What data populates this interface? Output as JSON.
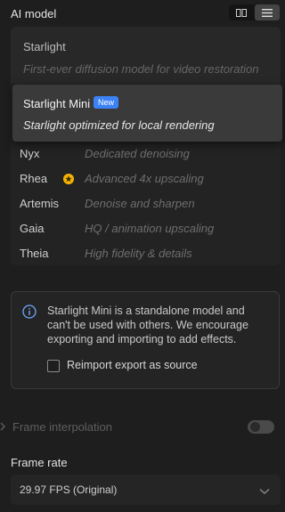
{
  "panel": {
    "title": "AI model"
  },
  "view_toggle": {
    "grid_icon": "grid-icon",
    "list_icon": "list-icon"
  },
  "dropdown": {
    "option": {
      "name": "Starlight",
      "desc": "First-ever diffusion model for video restoration"
    },
    "selected": {
      "name": "Starlight Mini",
      "badge": "New",
      "desc": "Starlight optimized for local rendering"
    }
  },
  "models": [
    {
      "name": "Nyx",
      "desc": "Dedicated denoising"
    },
    {
      "name": "Rhea",
      "desc": "Advanced 4x upscaling",
      "badge_icon": "star-badge-icon"
    },
    {
      "name": "Artemis",
      "desc": "Denoise and sharpen"
    },
    {
      "name": "Gaia",
      "desc": "HQ / animation upscaling"
    },
    {
      "name": "Theia",
      "desc": "High fidelity & details"
    }
  ],
  "info": {
    "icon": "info-icon",
    "text": "Starlight Mini is a standalone model and can't be used with others. We encourage exporting and importing to add effects.",
    "checkbox_label": "Reimport export as source",
    "checkbox_checked": false
  },
  "frame_interpolation": {
    "label": "Frame interpolation",
    "enabled": false
  },
  "frame_rate": {
    "label": "Frame rate",
    "value": "29.97 FPS (Original)"
  },
  "colors": {
    "accent": "#3b82f6",
    "star": "#f5b301"
  }
}
